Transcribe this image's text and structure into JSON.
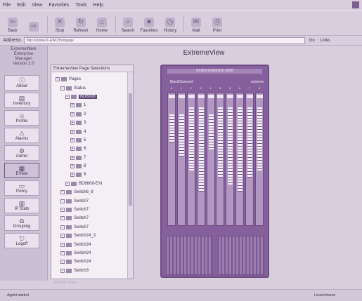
{
  "menubar": {
    "items": [
      "File",
      "Edit",
      "View",
      "Favorites",
      "Tools",
      "Help"
    ]
  },
  "toolbar": {
    "buttons": [
      {
        "label": "Back",
        "icon": "back-arrow-icon"
      },
      {
        "label": "",
        "icon": "forward-arrow-icon"
      },
      {
        "label": "Stop",
        "icon": "stop-icon"
      },
      {
        "label": "Refresh",
        "icon": "refresh-icon"
      },
      {
        "label": "Home",
        "icon": "home-icon"
      },
      {
        "label": "Search",
        "icon": "search-icon"
      },
      {
        "label": "Favorites",
        "icon": "favorites-icon"
      },
      {
        "label": "History",
        "icon": "history-icon"
      },
      {
        "label": "Mail",
        "icon": "mail-icon"
      },
      {
        "label": "Print",
        "icon": "print-icon"
      }
    ]
  },
  "addressbar": {
    "label": "Address",
    "url": "http://ubidev/1-EWC/frontpage",
    "go": "Go",
    "links": "Links"
  },
  "brand": {
    "line1": "ExtremeWare",
    "line2": "Enterprise",
    "line3": "Manager",
    "line4": "Version 2.0"
  },
  "nav": {
    "items": [
      {
        "label": "About",
        "icon": "about-icon"
      },
      {
        "label": "Inventory",
        "icon": "inventory-icon"
      },
      {
        "label": "Profile",
        "icon": "profile-icon"
      },
      {
        "label": "Alarms",
        "icon": "alarms-icon"
      },
      {
        "label": "Admin",
        "icon": "admin-icon"
      },
      {
        "label": "EView",
        "icon": "eview-icon"
      },
      {
        "label": "Policy",
        "icon": "policy-icon"
      },
      {
        "label": "IP Stats",
        "icon": "ip-stats-icon"
      },
      {
        "label": "Grouping",
        "icon": "grouping-icon"
      },
      {
        "label": "Logoff",
        "icon": "logoff-icon"
      }
    ]
  },
  "page": {
    "title": "ExtremeView"
  },
  "tree": {
    "header": "ExtremeView Page Selections",
    "nodes": [
      {
        "label": "Pages",
        "level": 0
      },
      {
        "label": "Status",
        "level": 1
      },
      {
        "label": "BD6808",
        "level": 2,
        "selected": true
      },
      {
        "label": "1",
        "level": 3
      },
      {
        "label": "2",
        "level": 3
      },
      {
        "label": "3",
        "level": 3
      },
      {
        "label": "4",
        "level": 3
      },
      {
        "label": "5",
        "level": 3
      },
      {
        "label": "6",
        "level": 3
      },
      {
        "label": "7",
        "level": 3
      },
      {
        "label": "8",
        "level": 3
      },
      {
        "label": "9",
        "level": 3
      },
      {
        "label": "BD6808-EXt",
        "level": 2
      },
      {
        "label": "Switch6_8",
        "level": 1
      },
      {
        "label": "Switch7",
        "level": 1
      },
      {
        "label": "Switch7",
        "level": 1
      },
      {
        "label": "Switch7",
        "level": 1
      },
      {
        "label": "Switch7",
        "level": 1
      },
      {
        "label": "Switch24_3",
        "level": 1
      },
      {
        "label": "Switch24",
        "level": 1
      },
      {
        "label": "Switch24",
        "level": 1
      },
      {
        "label": "Switch24",
        "level": 1
      },
      {
        "label": "Switch3",
        "level": 1
      }
    ]
  },
  "device": {
    "title": "BLACKDIAMOND 6808",
    "brand": "BlackDiamond",
    "logo": "extreme",
    "slot_labels": [
      "A",
      "1",
      "2",
      "3",
      "4",
      "B",
      "5",
      "6",
      "7",
      "8"
    ]
  },
  "status": {
    "panel": "BD6808 Status",
    "bar_left": "Applet started",
    "zone": "Local intranet"
  }
}
